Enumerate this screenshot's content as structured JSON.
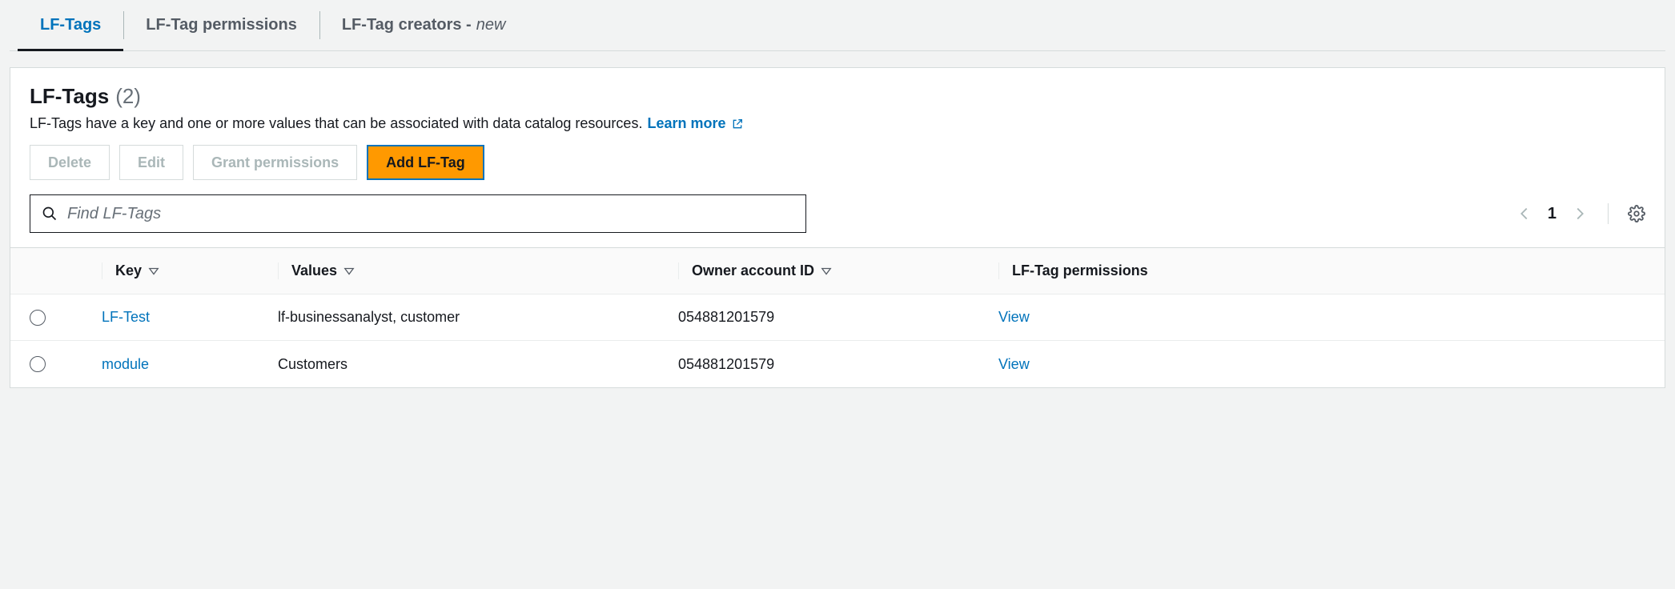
{
  "tabs": {
    "lfTags": "LF-Tags",
    "lfTagPerms": "LF-Tag permissions",
    "lfTagCreators": "LF-Tag creators -",
    "newBadge": "new"
  },
  "card": {
    "title": "LF-Tags",
    "count": "(2)",
    "desc": "LF-Tags have a key and one or more values that can be associated with data catalog resources.",
    "learnMore": "Learn more"
  },
  "actions": {
    "delete": "Delete",
    "edit": "Edit",
    "grant": "Grant permissions",
    "add": "Add LF-Tag"
  },
  "search": {
    "placeholder": "Find LF-Tags"
  },
  "pager": {
    "page": "1"
  },
  "table": {
    "headers": {
      "key": "Key",
      "values": "Values",
      "owner": "Owner account ID",
      "perm": "LF-Tag permissions"
    },
    "rows": [
      {
        "key": "LF-Test",
        "values": "lf-businessanalyst, customer",
        "owner": "054881201579",
        "perm": "View"
      },
      {
        "key": "module",
        "values": "Customers",
        "owner": "054881201579",
        "perm": "View"
      }
    ]
  }
}
